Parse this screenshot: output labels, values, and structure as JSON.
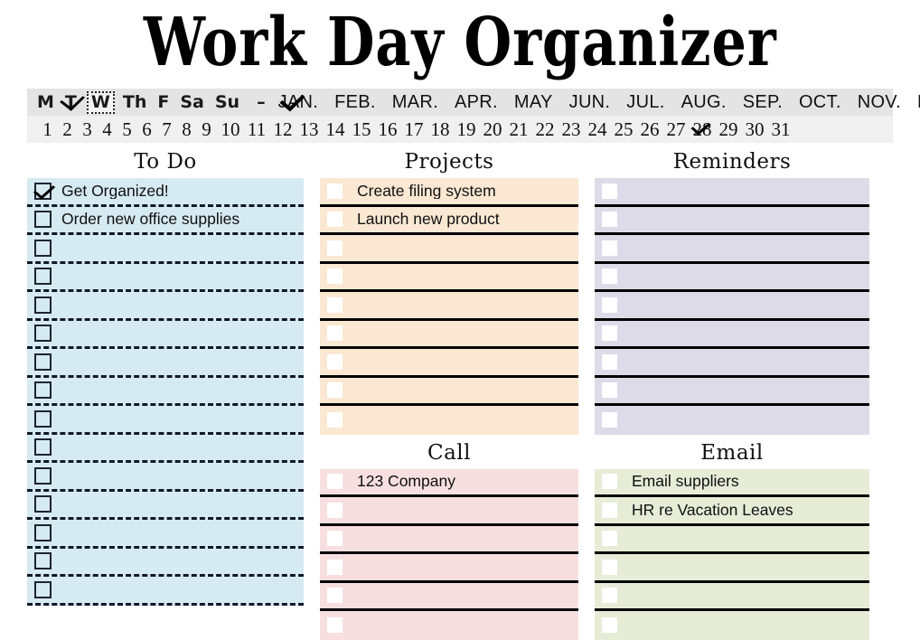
{
  "title": "Work Day Organizer",
  "date_strip": {
    "days_of_week": [
      {
        "label": "M",
        "checked": false,
        "selected": false
      },
      {
        "label": "T",
        "checked": true,
        "selected": false
      },
      {
        "label": "W",
        "checked": false,
        "selected": true
      },
      {
        "label": "Th",
        "checked": false,
        "selected": false
      },
      {
        "label": "F",
        "checked": false,
        "selected": false
      },
      {
        "label": "Sa",
        "checked": false,
        "selected": false
      },
      {
        "label": "Su",
        "checked": false,
        "selected": false
      }
    ],
    "separator": "–",
    "months": [
      {
        "label": "JAN.",
        "checked": true
      },
      {
        "label": "FEB.",
        "checked": false
      },
      {
        "label": "MAR.",
        "checked": false
      },
      {
        "label": "APR.",
        "checked": false
      },
      {
        "label": "MAY",
        "checked": false
      },
      {
        "label": "JUN.",
        "checked": false
      },
      {
        "label": "JUL.",
        "checked": false
      },
      {
        "label": "AUG.",
        "checked": false
      },
      {
        "label": "SEP.",
        "checked": false
      },
      {
        "label": "OCT.",
        "checked": false
      },
      {
        "label": "NOV.",
        "checked": false
      },
      {
        "label": "DEC.",
        "checked": false
      }
    ],
    "days": [
      {
        "label": "1",
        "checked": false
      },
      {
        "label": "2",
        "checked": false
      },
      {
        "label": "3",
        "checked": false
      },
      {
        "label": "4",
        "checked": false
      },
      {
        "label": "5",
        "checked": false
      },
      {
        "label": "6",
        "checked": false
      },
      {
        "label": "7",
        "checked": false
      },
      {
        "label": "8",
        "checked": false
      },
      {
        "label": "9",
        "checked": false
      },
      {
        "label": "10",
        "checked": false
      },
      {
        "label": "11",
        "checked": false
      },
      {
        "label": "12",
        "checked": false
      },
      {
        "label": "13",
        "checked": false
      },
      {
        "label": "14",
        "checked": false
      },
      {
        "label": "15",
        "checked": false
      },
      {
        "label": "16",
        "checked": false
      },
      {
        "label": "17",
        "checked": false
      },
      {
        "label": "18",
        "checked": false
      },
      {
        "label": "19",
        "checked": false
      },
      {
        "label": "20",
        "checked": false
      },
      {
        "label": "21",
        "checked": false
      },
      {
        "label": "22",
        "checked": false
      },
      {
        "label": "23",
        "checked": false
      },
      {
        "label": "24",
        "checked": false
      },
      {
        "label": "25",
        "checked": false
      },
      {
        "label": "26",
        "checked": false
      },
      {
        "label": "27",
        "checked": false
      },
      {
        "label": "28",
        "checked": true
      },
      {
        "label": "29",
        "checked": false
      },
      {
        "label": "30",
        "checked": false
      },
      {
        "label": "31",
        "checked": false
      }
    ]
  },
  "sections": {
    "todo": {
      "title": "To Do",
      "color": "#d6eaf2",
      "rows": [
        {
          "text": "Get Organized!",
          "checked": true
        },
        {
          "text": "Order new office supplies",
          "checked": false
        },
        {
          "text": "",
          "checked": false
        },
        {
          "text": "",
          "checked": false
        },
        {
          "text": "",
          "checked": false
        },
        {
          "text": "",
          "checked": false
        },
        {
          "text": "",
          "checked": false
        },
        {
          "text": "",
          "checked": false
        },
        {
          "text": "",
          "checked": false
        },
        {
          "text": "",
          "checked": false
        },
        {
          "text": "",
          "checked": false
        },
        {
          "text": "",
          "checked": false
        },
        {
          "text": "",
          "checked": false
        },
        {
          "text": "",
          "checked": false
        },
        {
          "text": "",
          "checked": false
        }
      ]
    },
    "projects": {
      "title": "Projects",
      "color": "#fbe8d3",
      "rows": [
        {
          "text": "Create filing system",
          "checked": false
        },
        {
          "text": "Launch new product",
          "checked": false
        },
        {
          "text": "",
          "checked": false
        },
        {
          "text": "",
          "checked": false
        },
        {
          "text": "",
          "checked": false
        },
        {
          "text": "",
          "checked": false
        },
        {
          "text": "",
          "checked": false
        },
        {
          "text": "",
          "checked": false
        },
        {
          "text": "",
          "checked": false
        }
      ]
    },
    "reminders": {
      "title": "Reminders",
      "color": "#dedbe9",
      "rows": [
        {
          "text": "",
          "checked": false
        },
        {
          "text": "",
          "checked": false
        },
        {
          "text": "",
          "checked": false
        },
        {
          "text": "",
          "checked": false
        },
        {
          "text": "",
          "checked": false
        },
        {
          "text": "",
          "checked": false
        },
        {
          "text": "",
          "checked": false
        },
        {
          "text": "",
          "checked": false
        },
        {
          "text": "",
          "checked": false
        }
      ]
    },
    "call": {
      "title": "Call",
      "color": "#f7dfe0",
      "rows": [
        {
          "text": "123 Company",
          "checked": false
        },
        {
          "text": "",
          "checked": false
        },
        {
          "text": "",
          "checked": false
        },
        {
          "text": "",
          "checked": false
        },
        {
          "text": "",
          "checked": false
        },
        {
          "text": "",
          "checked": false
        }
      ]
    },
    "email": {
      "title": "Email",
      "color": "#e6ecd6",
      "rows": [
        {
          "text": "Email suppliers",
          "checked": false
        },
        {
          "text": "HR re Vacation Leaves",
          "checked": false
        },
        {
          "text": "",
          "checked": false
        },
        {
          "text": "",
          "checked": false
        },
        {
          "text": "",
          "checked": false
        },
        {
          "text": "",
          "checked": false
        }
      ]
    }
  }
}
